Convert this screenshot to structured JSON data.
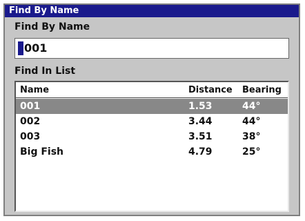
{
  "window": {
    "title": "Find By Name"
  },
  "search": {
    "label": "Find By Name",
    "value": "001"
  },
  "list": {
    "label": "Find In List",
    "columns": [
      "Name",
      "Distance",
      "Bearing"
    ],
    "rows": [
      {
        "name": "001",
        "distance": "1.53",
        "bearing": "44°",
        "selected": true
      },
      {
        "name": "002",
        "distance": "3.44",
        "bearing": "44°",
        "selected": false
      },
      {
        "name": "003",
        "distance": "3.51",
        "bearing": "38°",
        "selected": false
      },
      {
        "name": "Big Fish",
        "distance": "4.79",
        "bearing": "25°",
        "selected": false
      }
    ]
  }
}
